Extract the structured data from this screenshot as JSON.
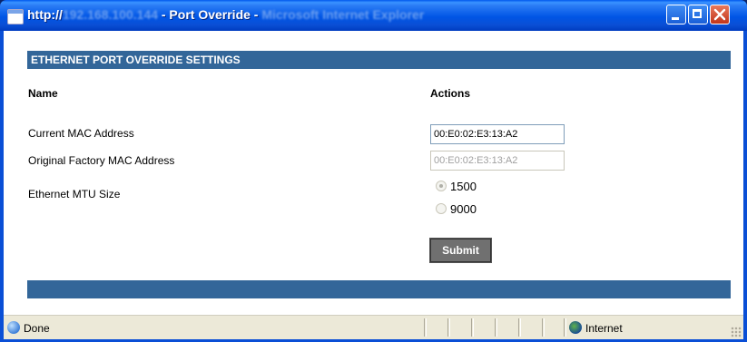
{
  "window": {
    "title_prefix": "http://",
    "title_host": "192.168.100.144",
    "title_page": " - Port Override - ",
    "title_app": "Microsoft Internet Explorer"
  },
  "section": {
    "header": "ETHERNET PORT OVERRIDE SETTINGS"
  },
  "columns": {
    "name": "Name",
    "actions": "Actions"
  },
  "rows": {
    "current_mac_label": "Current MAC Address",
    "current_mac_value": "00:E0:02:E3:13:A2",
    "factory_mac_label": "Original Factory MAC Address",
    "factory_mac_value": "00:E0:02:E3:13:A2",
    "mtu_label": "Ethernet MTU Size",
    "mtu_options": [
      "1500",
      "9000"
    ],
    "mtu_selected": "1500"
  },
  "buttons": {
    "submit": "Submit"
  },
  "status": {
    "text": "Done",
    "zone": "Internet"
  },
  "colors": {
    "section_header": "#336699",
    "titlebar": "#0055e5"
  },
  "icons": {
    "app": "ie-page-icon",
    "status": "ie-status-icon",
    "zone": "globe-icon"
  }
}
